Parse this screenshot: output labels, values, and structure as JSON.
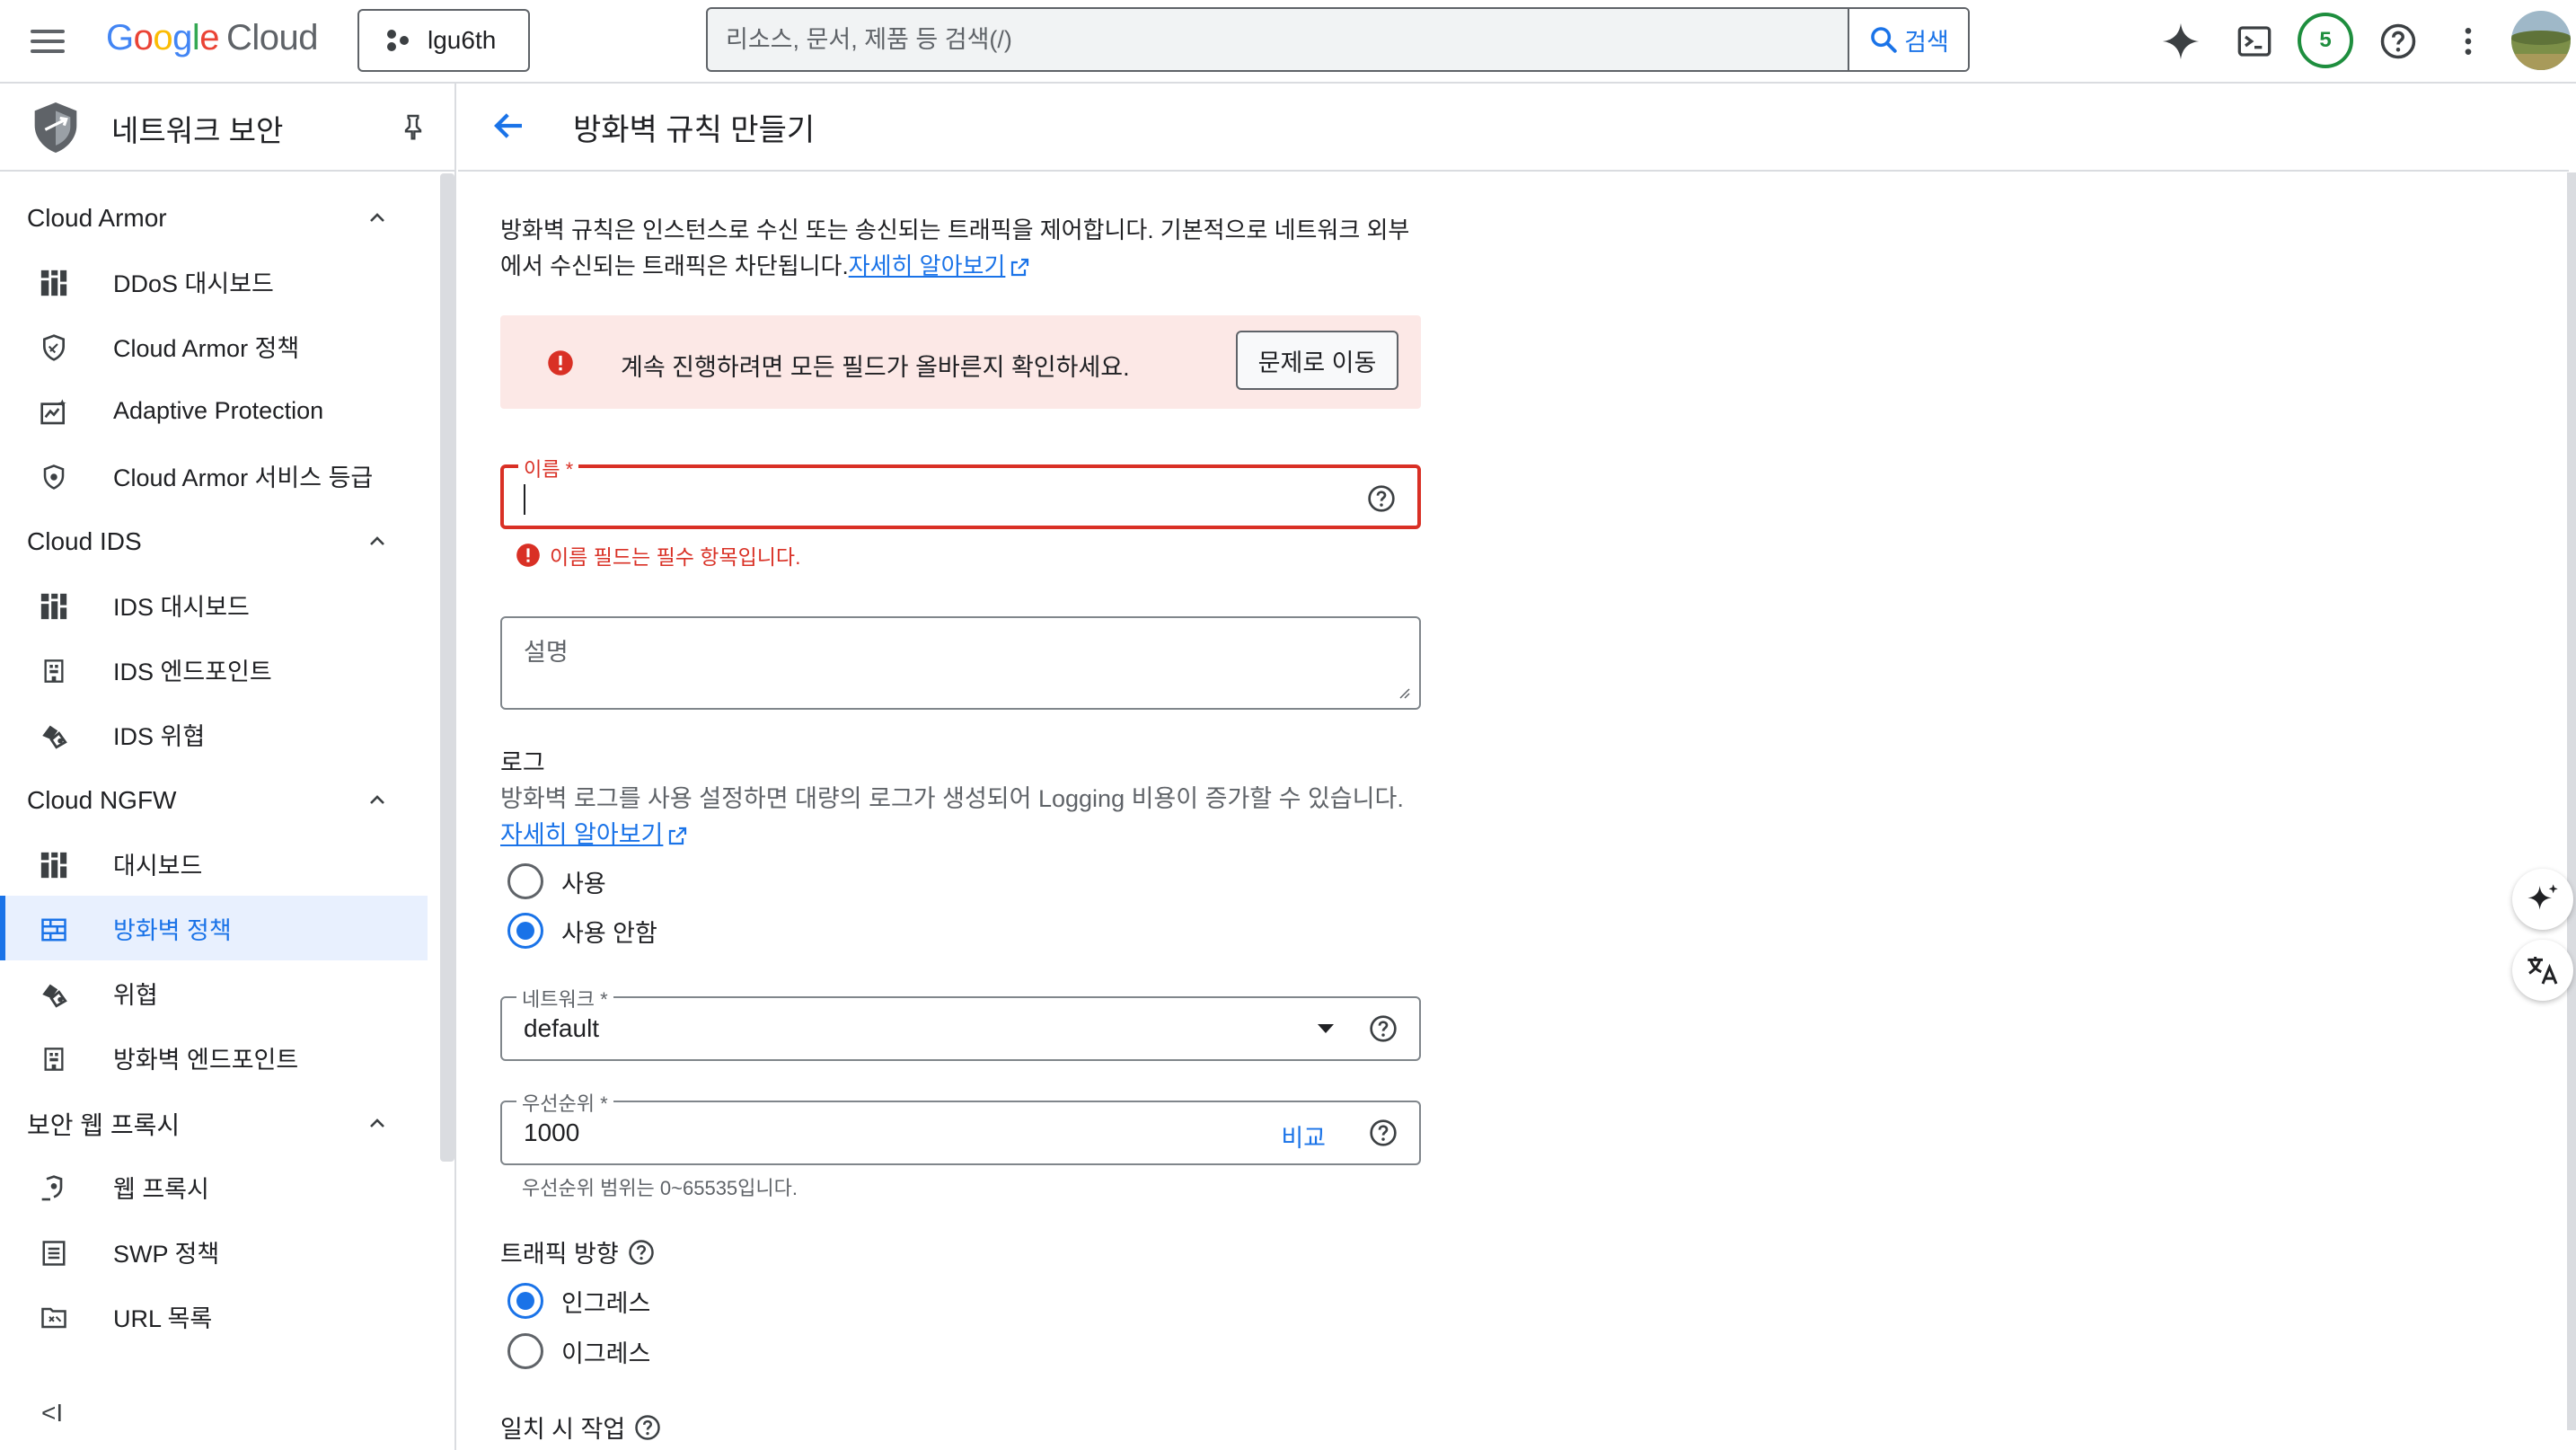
{
  "topbar": {
    "logo_google": [
      "G",
      "o",
      "o",
      "g",
      "l",
      "e"
    ],
    "logo_cloud": "Cloud",
    "project": "lgu6th",
    "search_placeholder": "리소스, 문서, 제품 등 검색(/)",
    "search_button": "검색",
    "notifications_count": "5"
  },
  "sidebar": {
    "title": "네트워크 보안",
    "sections": [
      {
        "label": "Cloud Armor",
        "items": [
          "DDoS 대시보드",
          "Cloud Armor 정책",
          "Adaptive Protection",
          "Cloud Armor 서비스 등급"
        ]
      },
      {
        "label": "Cloud IDS",
        "items": [
          "IDS 대시보드",
          "IDS 엔드포인트",
          "IDS 위협"
        ]
      },
      {
        "label": "Cloud NGFW",
        "items": [
          "대시보드",
          "방화벽 정책",
          "위협",
          "방화벽 엔드포인트"
        ]
      },
      {
        "label": "보안 웹 프록시",
        "items": [
          "웹 프록시",
          "SWP 정책",
          "URL 목록"
        ]
      }
    ],
    "active_item": "방화벽 정책",
    "collapse_label": "<I"
  },
  "main": {
    "title": "방화벽 규칙 만들기",
    "description": "방화벽 규칙은 인스턴스로 수신 또는 송신되는 트래픽을 제어합니다. 기본적으로 네트워크 외부에서 수신되는 트래픽은 차단됩니다.",
    "learn_more": "자세히 알아보기",
    "alert": {
      "text": "계속 진행하려면 모든 필드가 올바른지 확인하세요.",
      "button": "문제로 이동"
    },
    "name_field": {
      "label": "이름 *",
      "value": "",
      "error": "이름 필드는 필수 항목입니다."
    },
    "description_field": {
      "placeholder": "설명"
    },
    "logs": {
      "heading": "로그",
      "text": "방화벽 로그를 사용 설정하면 대량의 로그가 생성되어 Logging 비용이 증가할 수 있습니다.",
      "learn_more": "자세히 알아보기",
      "options": [
        "사용",
        "사용 안함"
      ],
      "selected": "사용 안함"
    },
    "network": {
      "label": "네트워크 *",
      "value": "default"
    },
    "priority": {
      "label": "우선순위 *",
      "value": "1000",
      "compare": "비교",
      "hint": "우선순위 범위는 0~65535입니다."
    },
    "traffic_direction": {
      "heading": "트래픽 방향",
      "options": [
        "인그레스",
        "이그레스"
      ],
      "selected": "인그레스"
    },
    "action_on_match": {
      "heading": "일치 시 작업"
    }
  },
  "colors": {
    "accent": "#1a73e8",
    "error": "#d93025",
    "alert_bg": "#fce8e6",
    "active_bg": "#e8f0fe"
  },
  "icons": [
    "hamburger-icon",
    "project-icon",
    "search-icon",
    "gemini-icon",
    "cloud-shell-icon",
    "help-icon",
    "more-vert-icon",
    "network-security-icon",
    "pin-icon",
    "chevron-up-icon",
    "dashboard-icon",
    "policy-icon",
    "adaptive-icon",
    "tier-icon",
    "endpoint-icon",
    "threat-icon",
    "firewall-icon",
    "proxy-icon",
    "list-icon",
    "url-icon",
    "back-arrow-icon",
    "error-icon",
    "external-link-icon",
    "dropdown-icon",
    "sparkle-icon",
    "translate-icon"
  ]
}
